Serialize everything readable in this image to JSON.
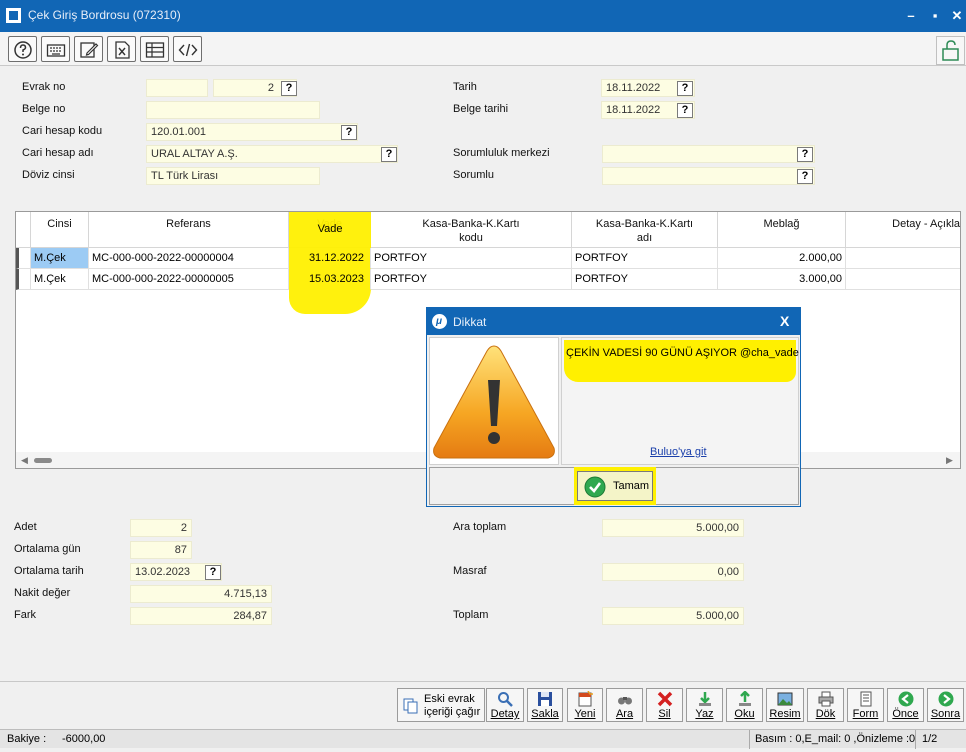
{
  "window": {
    "title": "Çek Giriş Bordrosu (072310)",
    "minimize": "–",
    "maximize": "▪",
    "close": "✕"
  },
  "toolbar": {
    "icons": [
      "help-icon",
      "keyboard-icon",
      "edit-icon",
      "excel-icon",
      "table-icon",
      "code-icon",
      "lock-icon"
    ]
  },
  "form": {
    "evrak_no_label": "Evrak no",
    "evrak_seri": "",
    "evrak_sira": "2",
    "belge_no_label": "Belge no",
    "belge_no": "",
    "cari_kodu_label": "Cari hesap kodu",
    "cari_kodu": "120.01.001",
    "cari_adi_label": "Cari hesap adı",
    "cari_adi": "URAL ALTAY A.Ş.",
    "doviz_label": "Döviz cinsi",
    "doviz": "TL  Türk Lirası",
    "tarih_label": "Tarih",
    "tarih": "18.11.2022",
    "belge_tarihi_label": "Belge tarihi",
    "belge_tarihi": "18.11.2022",
    "sorumluluk_label": "Sorumluluk merkezi",
    "sorumluluk": "",
    "sorumlu_label": "Sorumlu",
    "sorumlu": "",
    "help": "?"
  },
  "grid": {
    "headers": {
      "cinsi": "Cinsi",
      "referans": "Referans",
      "vade": "Vade",
      "kasa_kodu_1": "Kasa-Banka-K.Kartı",
      "kasa_kodu_2": "kodu",
      "kasa_adi_1": "Kasa-Banka-K.Kartı",
      "kasa_adi_2": "adı",
      "meblag": "Meblağ",
      "detay": "Detay - Açıkla"
    },
    "rows": [
      {
        "cinsi": "M.Çek",
        "referans": "MC-000-000-2022-00000004",
        "vade": "31.12.2022",
        "kasa_kodu": "PORTFOY",
        "kasa_adi": "PORTFOY",
        "meblag": "2.000,00",
        "detay": ""
      },
      {
        "cinsi": "M.Çek",
        "referans": "MC-000-000-2022-00000005",
        "vade": "15.03.2023",
        "kasa_kodu": "PORTFOY",
        "kasa_adi": "PORTFOY",
        "meblag": "3.000,00",
        "detay": ""
      }
    ]
  },
  "dialog": {
    "title": "Dikkat",
    "close": "X",
    "message": "ÇEKİN VADESİ 90 GÜNÜ AŞIYOR  @cha_vade",
    "link": "Buluo'ya git",
    "ok_label": "Tamam"
  },
  "summary": {
    "adet_label": "Adet",
    "adet": "2",
    "ort_gun_label": "Ortalama gün",
    "ort_gun": "87",
    "ort_tarih_label": "Ortalama tarih",
    "ort_tarih": "13.02.2023",
    "nakit_label": "Nakit değer",
    "nakit": "4.715,13",
    "fark_label": "Fark",
    "fark": "284,87",
    "ara_toplam_label": "Ara toplam",
    "ara_toplam": "5.000,00",
    "masraf_label": "Masraf",
    "masraf": "0,00",
    "toplam_label": "Toplam",
    "toplam": "5.000,00"
  },
  "buttons": {
    "eski_1": "Eski evrak",
    "eski_2": "içeriği çağır",
    "detay": "Detay",
    "sakla": "Sakla",
    "yeni": "Yeni",
    "ara": "Ara",
    "sil": "Sil",
    "yaz": "Yaz",
    "oku": "Oku",
    "resim": "Resim",
    "dok": "Dök",
    "form": "Form",
    "once": "Önce",
    "sonra": "Sonra"
  },
  "status": {
    "bakiye_label": "Bakiye :",
    "bakiye": "-6000,00",
    "info": "Basım : 0,E_mail: 0 ,Önizleme :0",
    "page": "1/2"
  },
  "colors": {
    "titlebar": "#1166b5",
    "field": "#fdfde3",
    "highlight": "#fff000",
    "selected_cell": "#9ccbf4"
  }
}
